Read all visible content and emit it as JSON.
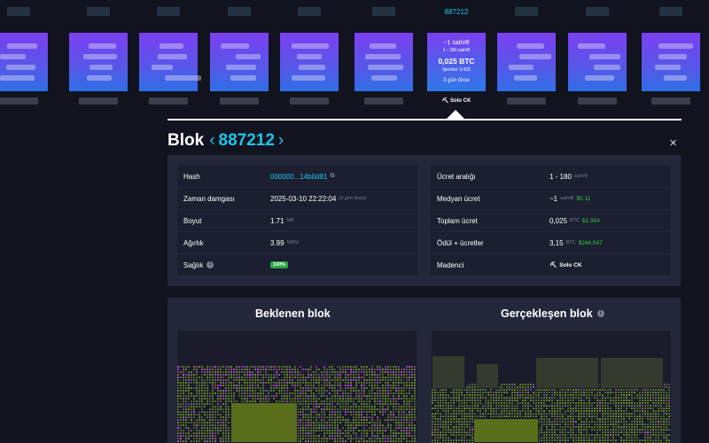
{
  "strip": {
    "current": {
      "height": "887212",
      "median_fee": "~1 sat/vB",
      "fee_range": "1 - 180 sat/vB",
      "total_btc": "0,025 BTC",
      "tx_count": "İşlemler 3.433",
      "time_ago": "3 gün önce",
      "pool": "Solo CK"
    }
  },
  "header": {
    "title": "Blok",
    "height": "887212",
    "prev_icon": "chevron-left-icon",
    "next_icon": "chevron-right-icon",
    "close_icon": "close-icon"
  },
  "details": {
    "left": [
      {
        "label": "Hash",
        "value": "000000...14b0d81"
      },
      {
        "label": "Zaman damgası",
        "value": "2025-03-10 22:22:04",
        "note": "(3 gün önce)"
      },
      {
        "label": "Boyut",
        "value": "1.71",
        "unit": "MB"
      },
      {
        "label": "Ağırlık",
        "value": "3.99",
        "unit": "MWU"
      },
      {
        "label": "Sağlık",
        "value": "100%"
      }
    ],
    "right": [
      {
        "label": "Ücret aralığı",
        "value": "1 - 180",
        "unit": "sat/vB"
      },
      {
        "label": "Medyan ücret",
        "value": "~1",
        "unit": "sat/vB",
        "usd": "$0.11"
      },
      {
        "label": "Toplam ücret",
        "value": "0,025",
        "unit": "BTC",
        "usd": "$1.954"
      },
      {
        "label": "Ödül + ücretler",
        "value": "3,15",
        "unit": "BTC",
        "usd": "$244.547"
      },
      {
        "label": "Madenci",
        "value": "Solo CK"
      }
    ]
  },
  "visual": {
    "expected_title": "Beklenen blok",
    "actual_title": "Gerçekleşen blok"
  },
  "colors": {
    "accent": "#20c5e8",
    "block_top": "#7b3ff2",
    "block_bottom": "#2f78e8",
    "green": "#2ecc40",
    "tx_green": "#6b8a2c",
    "tx_pink": "#c14ad8"
  }
}
